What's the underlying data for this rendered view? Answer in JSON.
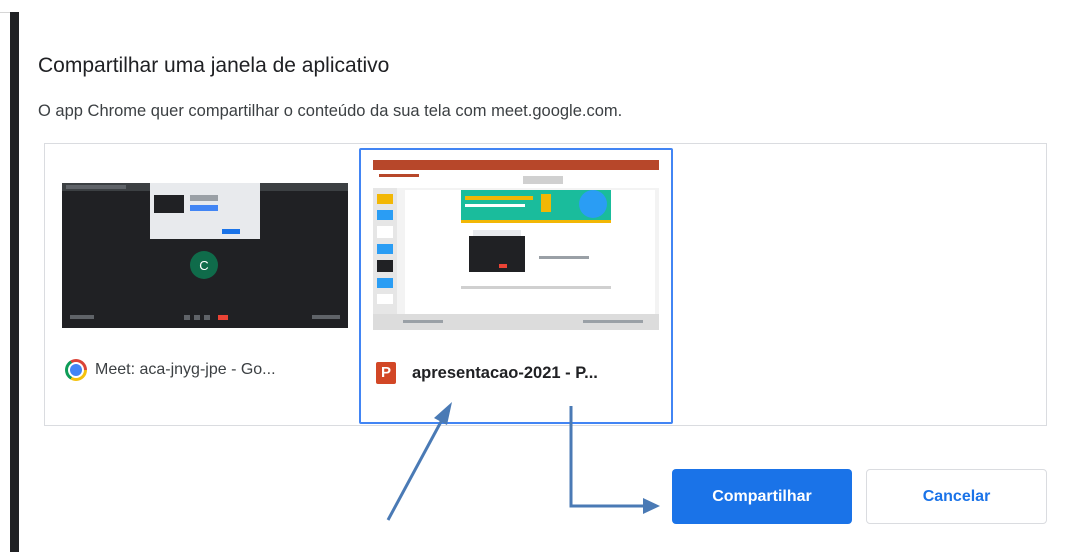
{
  "dialog": {
    "title": "Compartilhar uma janela de aplicativo",
    "subtitle": "O app Chrome quer compartilhar o conteúdo da sua tela com meet.google.com."
  },
  "sources": [
    {
      "label": "Meet: aca-jnyg-jpe - Go...",
      "icon": "chrome-icon",
      "selected": false,
      "avatar_letter": "C"
    },
    {
      "label": "apresentacao-2021 - P...",
      "icon": "powerpoint-icon",
      "selected": true
    }
  ],
  "buttons": {
    "share": "Compartilhar",
    "cancel": "Cancelar"
  },
  "colors": {
    "accent": "#1a73e8",
    "selection_border": "#4285f4",
    "annotation_arrow": "#4a7ab5"
  }
}
